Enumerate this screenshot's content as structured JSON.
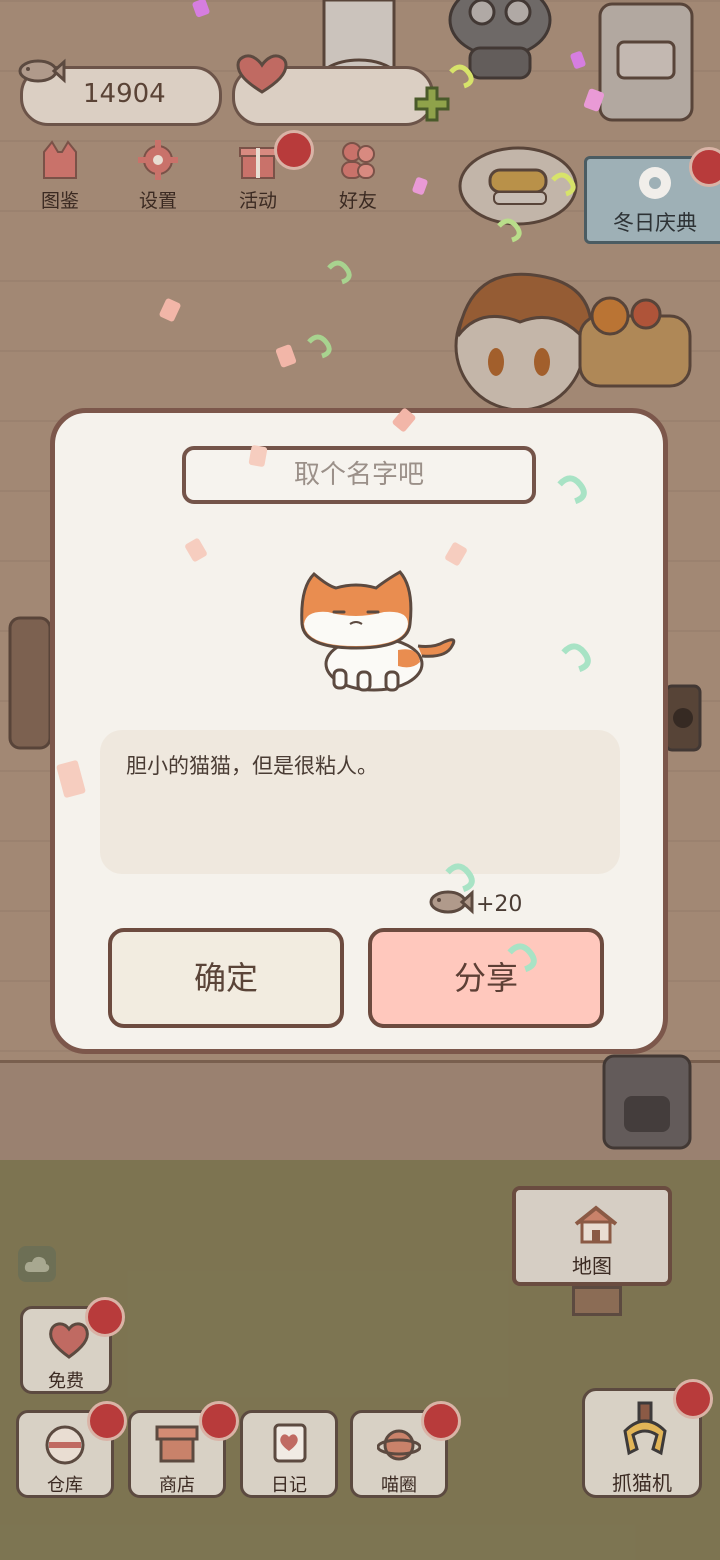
{
  "hud": {
    "fish_count": "14904",
    "menu": [
      {
        "label": "图鉴",
        "icon": "cat-head-icon",
        "badge": false
      },
      {
        "label": "设置",
        "icon": "gear-icon",
        "badge": false
      },
      {
        "label": "活动",
        "icon": "gift-icon",
        "badge": true
      },
      {
        "label": "好友",
        "icon": "friends-icon",
        "badge": false
      }
    ],
    "event_label": "冬日庆典"
  },
  "dialog": {
    "name_placeholder": "取个名字吧",
    "description": "胆小的猫猫，但是很粘人。",
    "reward_text": "+20",
    "confirm_label": "确定",
    "share_label": "分享"
  },
  "bottom": {
    "map_label": "地图",
    "free_label": "免费",
    "warehouse_label": "仓库",
    "shop_label": "商店",
    "diary_label": "日记",
    "meow_circle_label": "喵圈",
    "claw_label": "抓猫机"
  },
  "colors": {
    "badge_red": "#b83b3b",
    "share_pink": "#ffc8bd",
    "dialog_border": "#7c574b"
  }
}
